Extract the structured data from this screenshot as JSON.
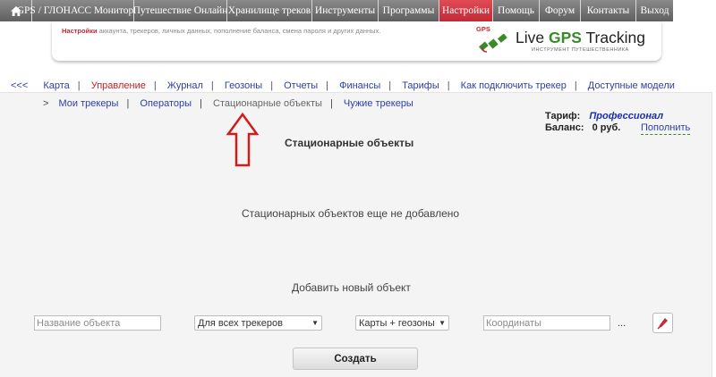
{
  "topnav": {
    "home_icon": "home-icon",
    "items": [
      "GPS / ГЛОНАСС Мониторинг",
      "Путешествие Онлайн",
      "Хранилище треков",
      "Инструменты",
      "Программы",
      "Настройки",
      "Помощь",
      "Форум",
      "Контакты",
      "Выход"
    ],
    "active": "Настройки",
    "active_color": "#c22a35"
  },
  "banner": {
    "highlight": "Настройки",
    "text": " аккаунта, трекеров, личных данных, пополнение баланса, смена пароля и других данных.",
    "logo": {
      "gps_label": "GPS",
      "title_prefix": "Live ",
      "title_accent": "GPS",
      "title_suffix": " Tracking",
      "subtitle": "ИНСТРУМЕНТ ПУТЕШЕСТВЕННИКА"
    }
  },
  "subnav": {
    "back": "<<<",
    "items": [
      "Карта",
      "Управление",
      "Журнал",
      "Геозоны",
      "Отчеты",
      "Финансы",
      "Тарифы",
      "Как подключить трекер",
      "Доступные модели"
    ],
    "active": "Управление"
  },
  "tabs": {
    "marker": ">",
    "items": [
      "Мои трекеры",
      "Операторы",
      "Стационарные объекты",
      "Чужие трекеры"
    ],
    "current": "Стационарные объекты"
  },
  "account": {
    "tariff_label": "Тариф:",
    "tariff_value": "Профессионал",
    "balance_label": "Баланс:",
    "balance_value": "0 руб.",
    "topup_link": "Пополнить"
  },
  "main": {
    "heading": "Стационарные объекты",
    "empty_message": "Стационарных объектов еще не добавлено",
    "add_title": "Добавить новый объект"
  },
  "form": {
    "name_placeholder": "Название объекта",
    "tracker_select": "Для всех трекеров",
    "layer_select": "Карты + геозоны",
    "coords_placeholder": "Координаты",
    "dots": "...",
    "pick_icon": "map-pin-picker-icon",
    "create_label": "Создать"
  },
  "annotation": {
    "arrow_icon": "red-arrow-up-icon",
    "arrow_color": "#d21b1b"
  }
}
